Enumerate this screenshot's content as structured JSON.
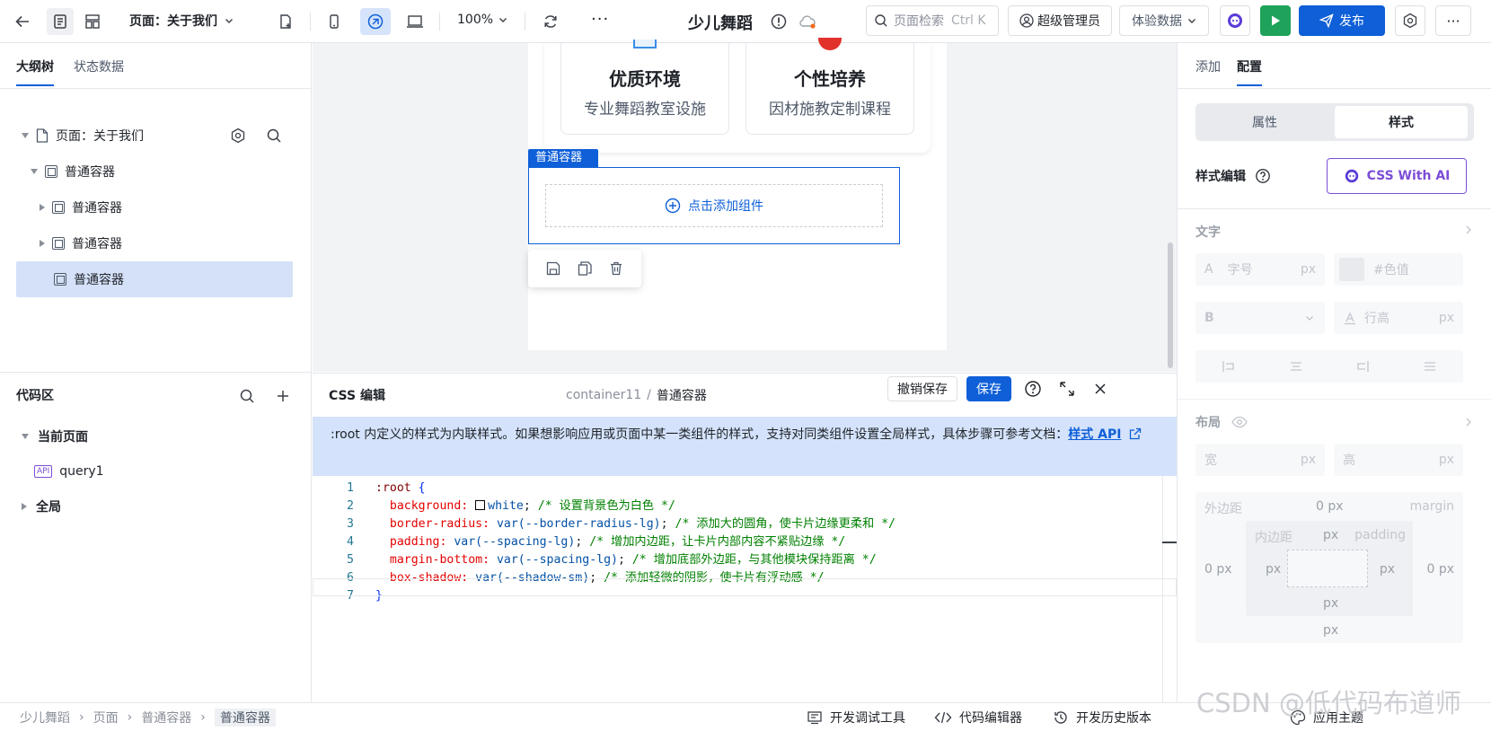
{
  "topbar": {
    "page_selector": "页面：关于我们",
    "zoom": "100%",
    "more": "···",
    "app_name": "少儿舞蹈",
    "search_placeholder": "页面检索",
    "search_shortcut": "Ctrl K",
    "user": "超级管理员",
    "data_mode": "体验数据",
    "publish": "发布"
  },
  "left": {
    "tabs": [
      "大纲树",
      "状态数据"
    ],
    "tree": [
      {
        "label": "页面：关于我们"
      },
      {
        "label": "普通容器"
      },
      {
        "label": "普通容器"
      },
      {
        "label": "普通容器"
      },
      {
        "label": "普通容器"
      }
    ],
    "code_area_title": "代码区",
    "current_page": "当前页面",
    "api_badge": "API",
    "query": "query1",
    "global": "全局"
  },
  "canvas": {
    "cards": [
      {
        "title": "优质环境",
        "desc": "专业舞蹈教室设施"
      },
      {
        "title": "个性培养",
        "desc": "因材施教定制课程"
      }
    ],
    "container_tag": "普通容器",
    "add_component": "点击添加组件"
  },
  "css_editor": {
    "title": "CSS 编辑",
    "path_id": "container11",
    "path_sep": "/",
    "path_name": "普通容器",
    "undo_save": "撤销保存",
    "save": "保存",
    "notice": ":root 内定义的样式为内联样式。如果想影响应用或页面中某一类组件的样式，支持对同类组件设置全局样式，具体步骤可参考文档：",
    "notice_link": "样式 API",
    "code": [
      {
        "n": "1",
        "parts": [
          [
            ":root ",
            "#800000"
          ],
          [
            "{",
            "#0431fa"
          ]
        ]
      },
      {
        "n": "2",
        "parts": [
          [
            "  background: ",
            "#e50000"
          ],
          [
            "SWATCH",
            "#000"
          ],
          [
            "white",
            "#0451a5"
          ],
          [
            "; ",
            "#1f2329"
          ],
          [
            "/* 设置背景色为白色 */",
            "#008000"
          ]
        ]
      },
      {
        "n": "3",
        "parts": [
          [
            "  border-radius: ",
            "#e50000"
          ],
          [
            "var(--border-radius-lg)",
            "#0451a5"
          ],
          [
            "; ",
            "#1f2329"
          ],
          [
            "/* 添加大的圆角，使卡片边缘更柔和 */",
            "#008000"
          ]
        ]
      },
      {
        "n": "4",
        "parts": [
          [
            "  padding: ",
            "#e50000"
          ],
          [
            "var(--spacing-lg)",
            "#0451a5"
          ],
          [
            "; ",
            "#1f2329"
          ],
          [
            "/* 增加内边距，让卡片内部内容不紧贴边缘 */",
            "#008000"
          ]
        ]
      },
      {
        "n": "5",
        "parts": [
          [
            "  margin-bottom: ",
            "#e50000"
          ],
          [
            "var(--spacing-lg)",
            "#0451a5"
          ],
          [
            "; ",
            "#1f2329"
          ],
          [
            "/* 增加底部外边距，与其他模块保持距离 */",
            "#008000"
          ]
        ]
      },
      {
        "n": "6",
        "parts": [
          [
            "  box-shadow: ",
            "#e50000"
          ],
          [
            "var(--shadow-sm)",
            "#0451a5"
          ],
          [
            "; ",
            "#1f2329"
          ],
          [
            "/* 添加轻微的阴影，使卡片有浮动感 */",
            "#008000"
          ]
        ]
      },
      {
        "n": "7",
        "parts": [
          [
            "}",
            "#0431fa"
          ]
        ]
      }
    ]
  },
  "right": {
    "tabs": [
      "添加",
      "配置"
    ],
    "segments": [
      "属性",
      "样式"
    ],
    "style_edit": "样式编辑",
    "css_ai": "CSS With AI",
    "text_section": "文字",
    "font_size_placeholder": "字号",
    "unit_px": "px",
    "color_placeholder": "#色值",
    "line_height_placeholder": "行高",
    "layout_section": "布局",
    "width_label": "宽",
    "height_label": "高",
    "margin_label": "外边距",
    "margin_en": "margin",
    "padding_label": "内边距",
    "padding_en": "padding",
    "zero_px": "0 px",
    "px": "px"
  },
  "bottom": {
    "breadcrumb": [
      "少儿舞蹈",
      "页面",
      "普通容器",
      "普通容器"
    ],
    "debug_tool": "开发调试工具",
    "code_editor": "代码编辑器",
    "history": "开发历史版本",
    "theme": "应用主题",
    "watermark": "CSDN @低代码布道师"
  },
  "colors": {
    "primary": "#0e5fd8",
    "run_green": "#1fa35a",
    "notice_bg": "#d4e3fb",
    "selected_tree": "#d4e1f8"
  }
}
